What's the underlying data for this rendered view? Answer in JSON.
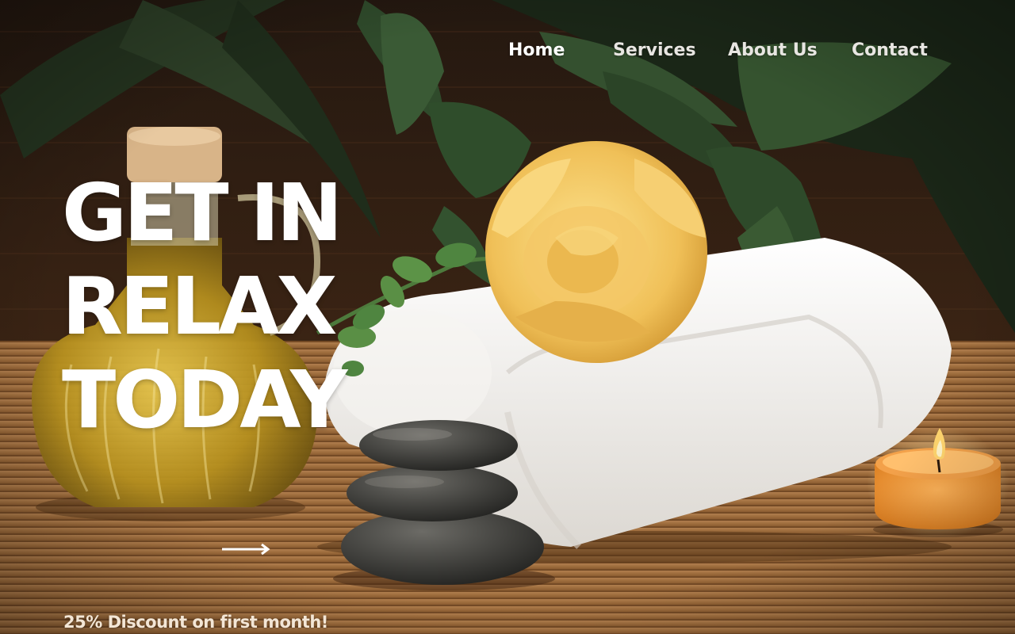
{
  "nav": {
    "items": [
      {
        "label": "Home",
        "active": true
      },
      {
        "label": "Services",
        "active": false
      },
      {
        "label": "About Us",
        "active": false
      },
      {
        "label": "Contact",
        "active": false
      }
    ]
  },
  "hero": {
    "headline": [
      "GET IN",
      "RELAX",
      "TODAY"
    ],
    "cta_icon": "arrow-right-icon",
    "promo": "25% Discount on first month!"
  },
  "colors": {
    "text": "#ffffff",
    "nav_text": "#e8e6e2",
    "promo_text": "#f3e6d6",
    "mat": "#b5804a",
    "foliage": "#24331f"
  }
}
